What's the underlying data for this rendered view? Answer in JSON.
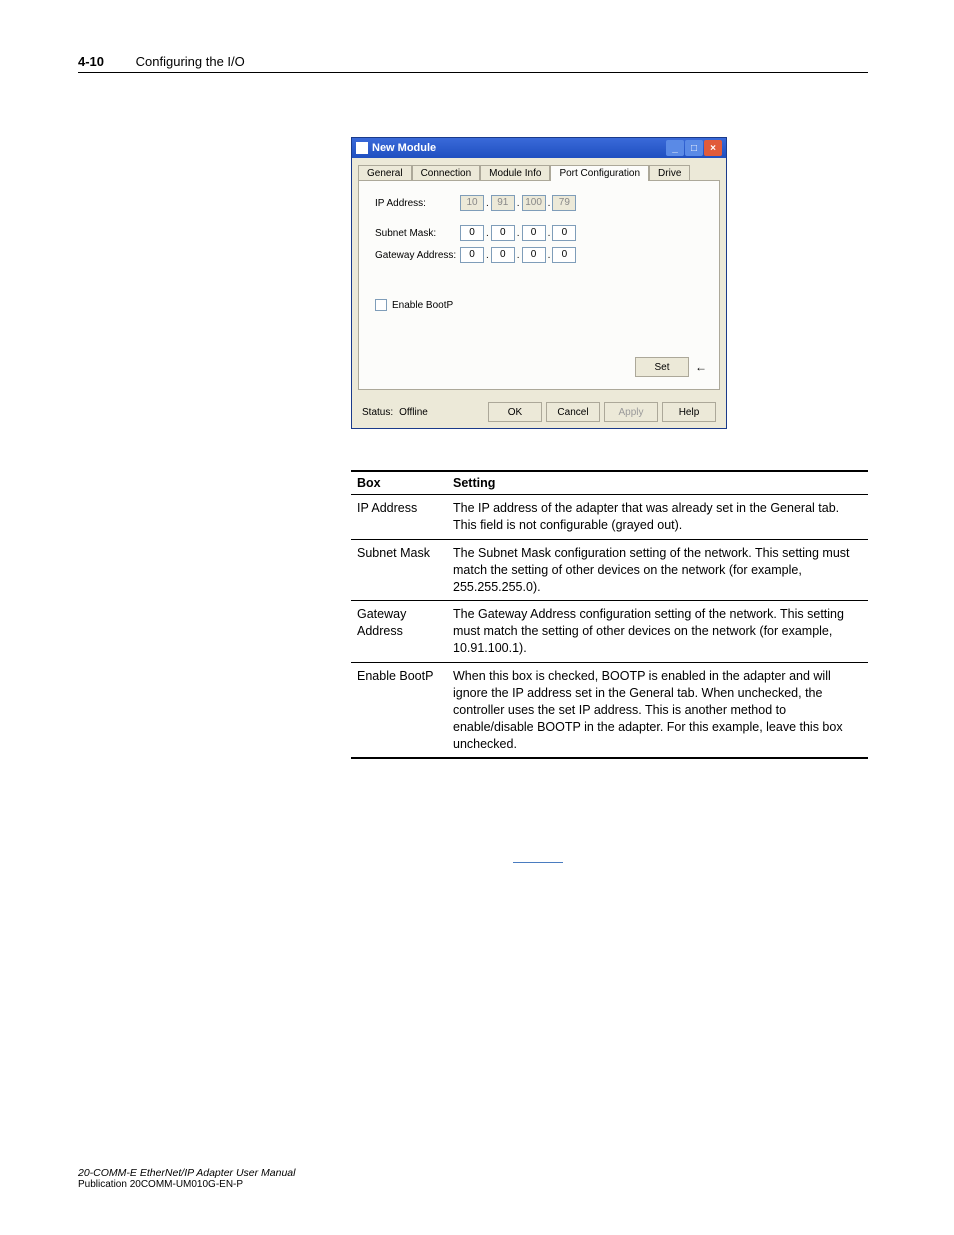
{
  "header": {
    "page_num": "4-10",
    "chapter_title": "Configuring the I/O"
  },
  "dialog": {
    "title": "New Module",
    "tabs": [
      "General",
      "Connection",
      "Module Info",
      "Port Configuration",
      "Drive"
    ],
    "active_tab_index": 3,
    "fields": {
      "ip_label": "IP Address:",
      "subnet_label": "Subnet Mask:",
      "gateway_label": "Gateway Address:",
      "ip": [
        "10",
        "91",
        "100",
        "79"
      ],
      "subnet": [
        "0",
        "0",
        "0",
        "0"
      ],
      "gateway": [
        "0",
        "0",
        "0",
        "0"
      ]
    },
    "checkbox": {
      "label": "Enable BootP",
      "checked": false
    },
    "buttons": {
      "set": "Set",
      "ok": "OK",
      "cancel": "Cancel",
      "apply": "Apply",
      "help": "Help"
    },
    "status": {
      "label": "Status:",
      "value": "Offline"
    },
    "win_icons": {
      "min": "_",
      "max": "□",
      "close": "×"
    }
  },
  "table": {
    "headers": [
      "Box",
      "Setting"
    ],
    "rows": [
      {
        "box": "IP Address",
        "setting": "The IP address of the adapter that was already set in the General tab. This field is not configurable (grayed out)."
      },
      {
        "box": "Subnet Mask",
        "setting": "The Subnet Mask configuration setting of the network. This setting must match the setting of other devices on the network (for example, 255.255.255.0)."
      },
      {
        "box": "Gateway Address",
        "setting": "The Gateway Address configuration setting of the network. This setting must match the setting of other devices on the network (for example, 10.91.100.1)."
      },
      {
        "box": "Enable BootP",
        "setting": "When this box is checked, BOOTP is enabled in the adapter and will ignore the IP address set in the General tab. When unchecked, the controller uses the set IP address. This is another method to enable/disable BOOTP in the adapter. For this example, leave this box unchecked."
      }
    ]
  },
  "footer": {
    "manual": "20-COMM-E EtherNet/IP Adapter User Manual",
    "publication": "Publication 20COMM-UM010G-EN-P"
  }
}
